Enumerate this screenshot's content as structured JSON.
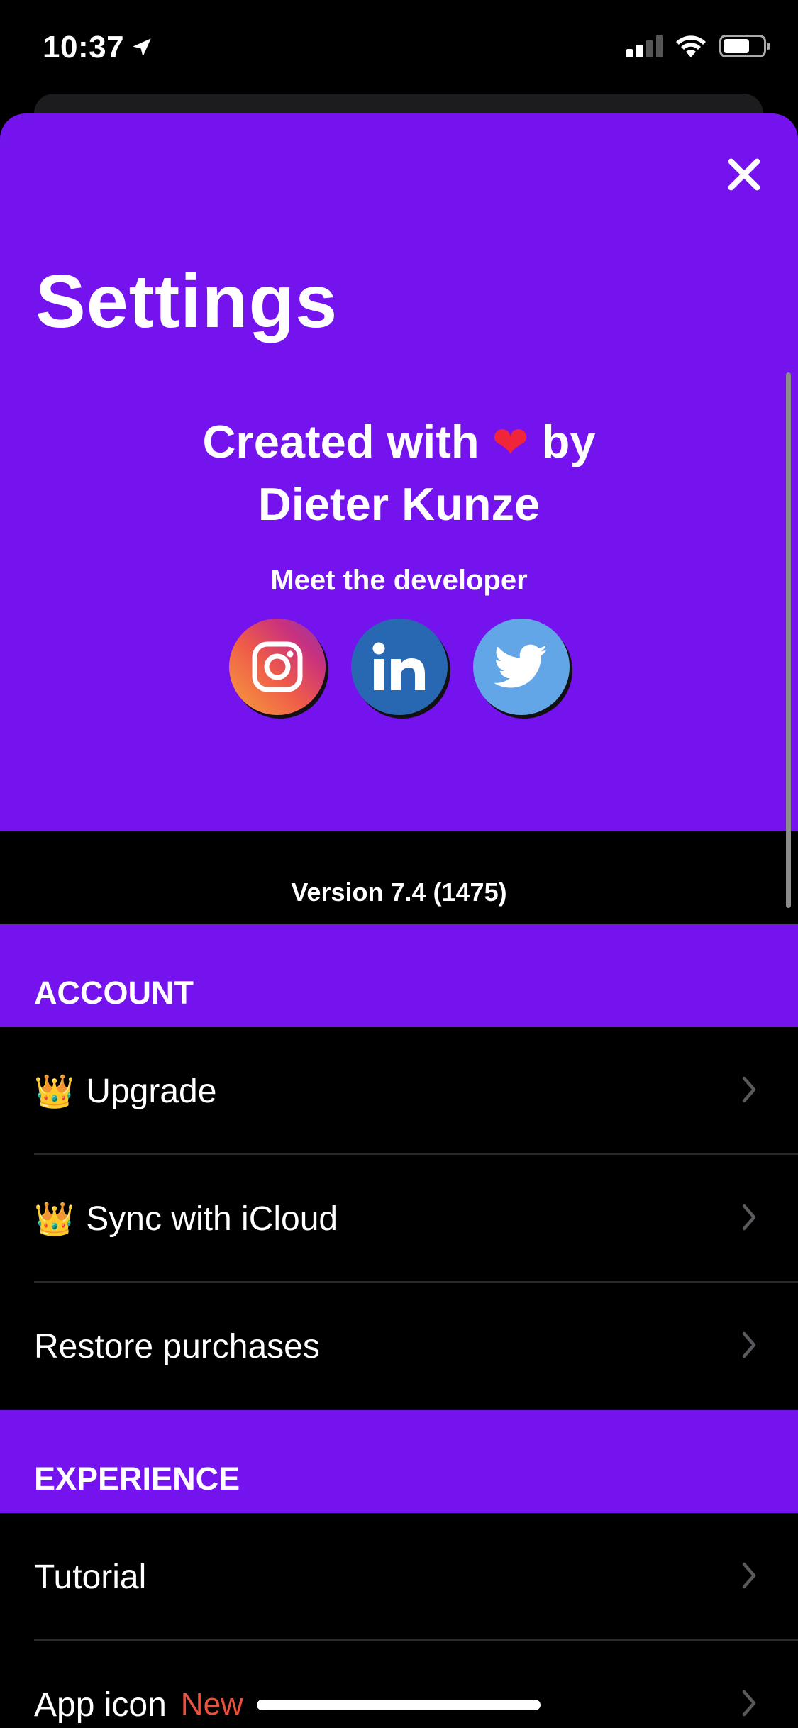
{
  "status_bar": {
    "time": "10:37"
  },
  "header": {
    "title": "Settings",
    "credit_line1_prefix": "Created with",
    "heart_glyph": "❤",
    "credit_line1_suffix": "by",
    "credit_line2": "Dieter Kunze",
    "meet_label": "Meet the developer",
    "socials": [
      "instagram-icon",
      "linkedin-icon",
      "twitter-icon"
    ],
    "version": "Version 7.4 (1475)"
  },
  "sections": {
    "account": {
      "title": "ACCOUNT",
      "items": [
        {
          "label": "Upgrade",
          "icon": "crown-icon"
        },
        {
          "label": "Sync with iCloud",
          "icon": "crown-icon"
        },
        {
          "label": "Restore purchases"
        }
      ]
    },
    "experience": {
      "title": "EXPERIENCE",
      "items": [
        {
          "label": "Tutorial"
        },
        {
          "label": "App icon",
          "badge": "New"
        }
      ]
    }
  },
  "colors": {
    "brand_purple": "#7413EE",
    "badge_red": "#E8523F",
    "background": "#000000"
  }
}
